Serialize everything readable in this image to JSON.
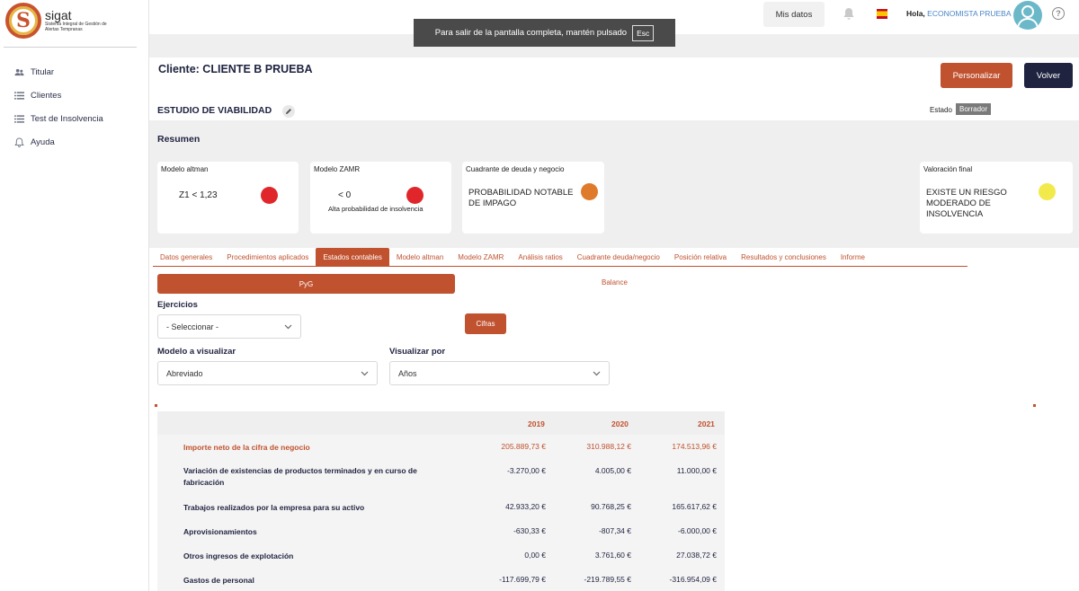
{
  "brand": {
    "name": "sigat",
    "subtitle": "Sistema Integral de Gestión de Alertas Tempranas",
    "letter": "S"
  },
  "sidebar": {
    "items": [
      {
        "label": "Titular",
        "icon": "users-icon"
      },
      {
        "label": "Clientes",
        "icon": "list-icon"
      },
      {
        "label": "Test de Insolvencia",
        "icon": "list-icon"
      },
      {
        "label": "Ayuda",
        "icon": "bell-icon"
      }
    ]
  },
  "topbar": {
    "mis_datos": "Mis datos",
    "greeting": "Hola,",
    "user": "ECONOMISTA PRUEBA",
    "help": "?"
  },
  "fullscreen": {
    "message": "Para salir de la pantalla completa, mantén pulsado",
    "key": "Esc"
  },
  "header": {
    "cliente": "Cliente: CLIENTE B PRUEBA",
    "personalizar": "Personalizar",
    "volver": "Volver"
  },
  "estudio": {
    "title": "ESTUDIO DE VIABILIDAD",
    "estado_label": "Estado",
    "estado_value": "Borrador"
  },
  "resumen": {
    "title": "Resumen",
    "cards": [
      {
        "title": "Modelo altman",
        "value": "Z1 < 1,23",
        "sub": "",
        "color": "#e0262b"
      },
      {
        "title": "Modelo ZAMR",
        "value": "< 0",
        "sub": "Alta probabilidad de insolvencia",
        "color": "#e0262b"
      },
      {
        "title": "Cuadrante de deuda y negocio",
        "value": "PROBABILIDAD NOTABLE DE IMPAGO",
        "sub": "",
        "color": "#e07a2b"
      },
      {
        "title": "Valoración final",
        "value": "EXISTE UN RIESGO MODERADO DE INSOLVENCIA",
        "sub": "",
        "color": "#f2ea4a"
      }
    ]
  },
  "tabs": [
    "Datos generales",
    "Procedimientos aplicados",
    "Estados contables",
    "Modelo altman",
    "Modelo ZAMR",
    "Análisis ratios",
    "Cuadrante deuda/negocio",
    "Posición relativa",
    "Resultados y conclusiones",
    "Informe"
  ],
  "active_tab": "Estados contables",
  "subtabs": {
    "pyg": "PyG",
    "balance": "Balance"
  },
  "filters": {
    "ejercicios_label": "Ejercicios",
    "ejercicios_value": "- Seleccionar -",
    "cifras": "Cifras",
    "modelo_label": "Modelo a visualizar",
    "modelo_value": "Abreviado",
    "visualizar_label": "Visualizar por",
    "visualizar_value": "Años"
  },
  "table": {
    "years": [
      "2019",
      "2020",
      "2021"
    ],
    "rows": [
      {
        "label": "Importe neto de la cifra de negocio",
        "values": [
          "205.889,73 €",
          "310.988,12 €",
          "174.513,96 €"
        ],
        "highlight": true
      },
      {
        "label": "Variación de existencias de productos terminados y en curso de fabricación",
        "values": [
          "-3.270,00 €",
          "4.005,00 €",
          "11.000,00 €"
        ],
        "highlight": false
      },
      {
        "label": "Trabajos realizados por la empresa para su activo",
        "values": [
          "42.933,20 €",
          "90.768,25 €",
          "165.617,62 €"
        ],
        "highlight": false
      },
      {
        "label": "Aprovisionamientos",
        "values": [
          "-630,33 €",
          "-807,34 €",
          "-6.000,00 €"
        ],
        "highlight": false
      },
      {
        "label": "Otros ingresos de explotación",
        "values": [
          "0,00 €",
          "3.761,60 €",
          "27.038,72 €"
        ],
        "highlight": false
      },
      {
        "label": "Gastos de personal",
        "values": [
          "-117.699,79 €",
          "-219.789,55 €",
          "-316.954,09 €"
        ],
        "highlight": false
      }
    ]
  }
}
